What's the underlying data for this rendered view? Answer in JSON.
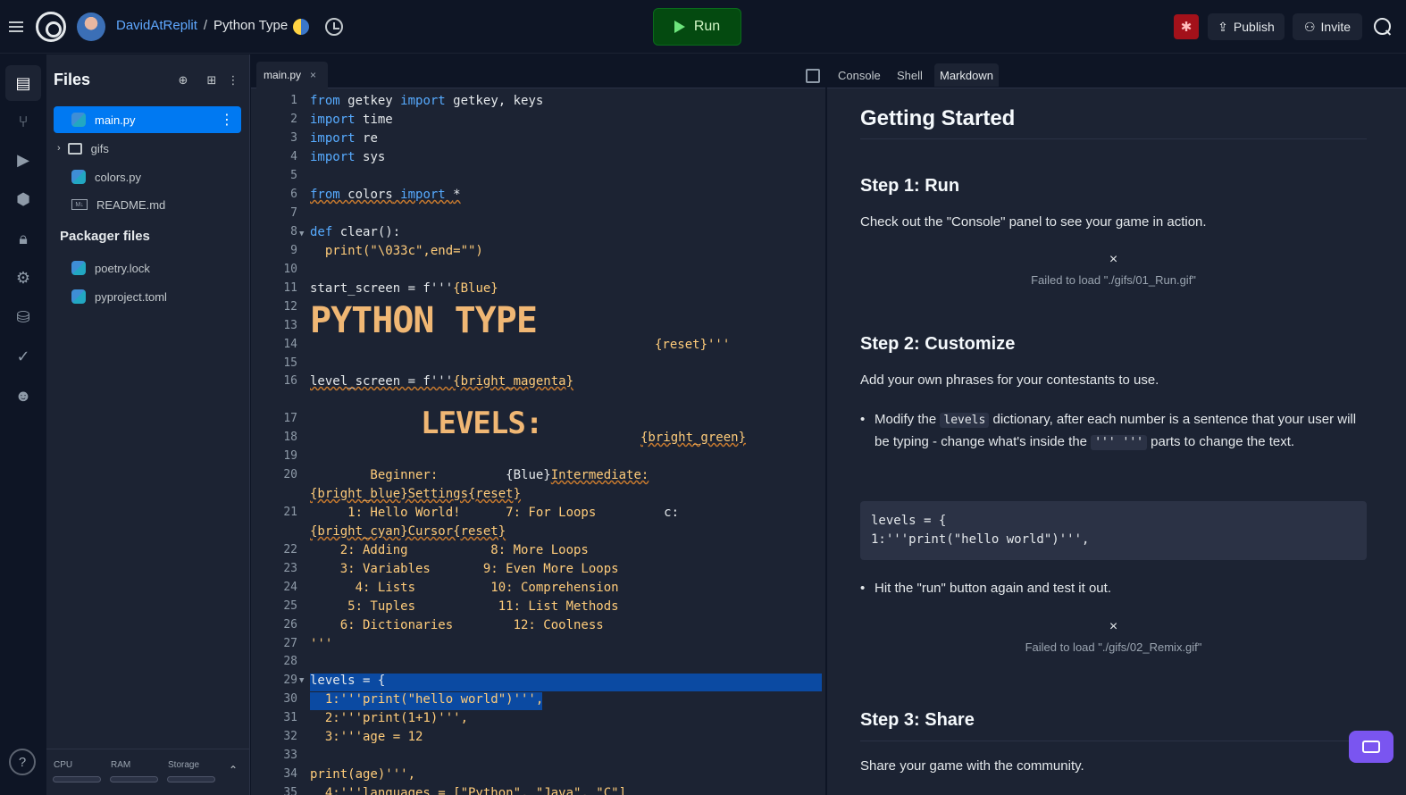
{
  "header": {
    "user": "DavidAtReplit",
    "separator": "/",
    "repl_name": "Python Type",
    "run_label": "Run",
    "publish_label": "Publish",
    "invite_label": "Invite"
  },
  "rail": {
    "items": [
      "files-icon",
      "git-icon",
      "debugger-icon",
      "packages-icon",
      "secrets-icon",
      "settings-icon",
      "database-icon",
      "check-icon",
      "alien-icon"
    ],
    "help_label": "?"
  },
  "files": {
    "title": "Files",
    "items": [
      {
        "name": "main.py",
        "type": "python"
      },
      {
        "name": "gifs",
        "type": "folder"
      },
      {
        "name": "colors.py",
        "type": "python"
      },
      {
        "name": "README.md",
        "type": "markdown"
      }
    ],
    "packager_title": "Packager files",
    "packager_items": [
      {
        "name": "poetry.lock",
        "type": "python"
      },
      {
        "name": "pyproject.toml",
        "type": "python"
      }
    ],
    "resources": [
      {
        "label": "CPU"
      },
      {
        "label": "RAM"
      },
      {
        "label": "Storage"
      }
    ]
  },
  "editor": {
    "tab_label": "main.py",
    "tab_close": "×",
    "line_numbers": [
      "1",
      "2",
      "3",
      "4",
      "5",
      "6",
      "7",
      "8",
      "9",
      "10",
      "11",
      "12",
      "13",
      "14",
      "15",
      "16",
      "17",
      "18",
      "19",
      "20",
      "21",
      "22",
      "23",
      "24",
      "25",
      "26",
      "27",
      "28",
      "29",
      "30",
      "31",
      "32",
      "33",
      "34",
      "35"
    ],
    "lines": {
      "l1a": "from ",
      "l1b": "getkey",
      "l1c": " import ",
      "l1d": "getkey, keys",
      "l2a": "import ",
      "l2b": "time",
      "l3a": "import ",
      "l3b": "re",
      "l4a": "import ",
      "l4b": "sys",
      "l6a": "from ",
      "l6b": "colors",
      "l6c": " import ",
      "l6d": "*",
      "l8a": "def ",
      "l8b": "clear():",
      "l9": "  print(\"\\033c\",end=\"\")",
      "l11a": "start_screen = f'''",
      "l11b": "{Blue}",
      "l12": "PYTHON TYPE",
      "l14": "{reset}'''",
      "l16a": "level_screen = f'''",
      "l16b": "{bright_magenta}",
      "l17": "LEVELS:",
      "l18": "{bright_green}",
      "l20a": "        Beginner:         ",
      "l20b": "{Blue}",
      "l20c": "Intermediate:",
      "l20d": "{bright_blue}Settings{reset}",
      "l21a": "     1: Hello World!      7: For Loops         ",
      "l21b": "c:",
      "l21c": "{bright_cyan}Cursor{reset}",
      "l22": "    2: Adding           8: More Loops",
      "l23": "    3: Variables       9: Even More Loops",
      "l24": "      4: Lists          10: Comprehension",
      "l25": "     5: Tuples           11: List Methods",
      "l26": "    6: Dictionaries        12: Coolness",
      "l27": "'''",
      "l29": "levels = {",
      "l30": "  1:'''print(\"hello world\")''',",
      "l31": "  2:'''print(1+1)''',",
      "l32": "  3:'''age = 12",
      "l34": "print(age)''',",
      "l35": "  4:'''languages = [\"Python\", \"Java\", \"C\"]"
    }
  },
  "right_pane": {
    "tabs": [
      "Console",
      "Shell",
      "Markdown"
    ],
    "markdown": {
      "h1": "Getting Started",
      "step1_title": "Step 1: Run",
      "step1_text": "Check out the \"Console\" panel to see your game in action.",
      "fail_x": "×",
      "step1_img_fail": "Failed to load \"./gifs/01_Run.gif\"",
      "step2_title": "Step 2: Customize",
      "step2_text": "Add your own phrases for your contestants to use.",
      "li1_a": "Modify the ",
      "li1_code": "levels",
      "li1_b": " dictionary, after each number is a sentence that your user will be typing - change what's inside the ",
      "li1_code2": "''' '''",
      "li1_c": " parts to change the text.",
      "code_line1": "levels = {",
      "code_line2": "1:'''print(\"hello world\")''',",
      "li2": "Hit the \"run\" button again and test it out.",
      "step2_img_fail": "Failed to load \"./gifs/02_Remix.gif\"",
      "step3_title": "Step 3: Share",
      "step3_text": "Share your game with the community."
    }
  },
  "colors": {
    "background": "#0e1525",
    "panel": "#1c2333",
    "accent": "#0079f2",
    "run_green": "#044a10",
    "keyword": "#57abff",
    "string": "#ffcc7a"
  }
}
